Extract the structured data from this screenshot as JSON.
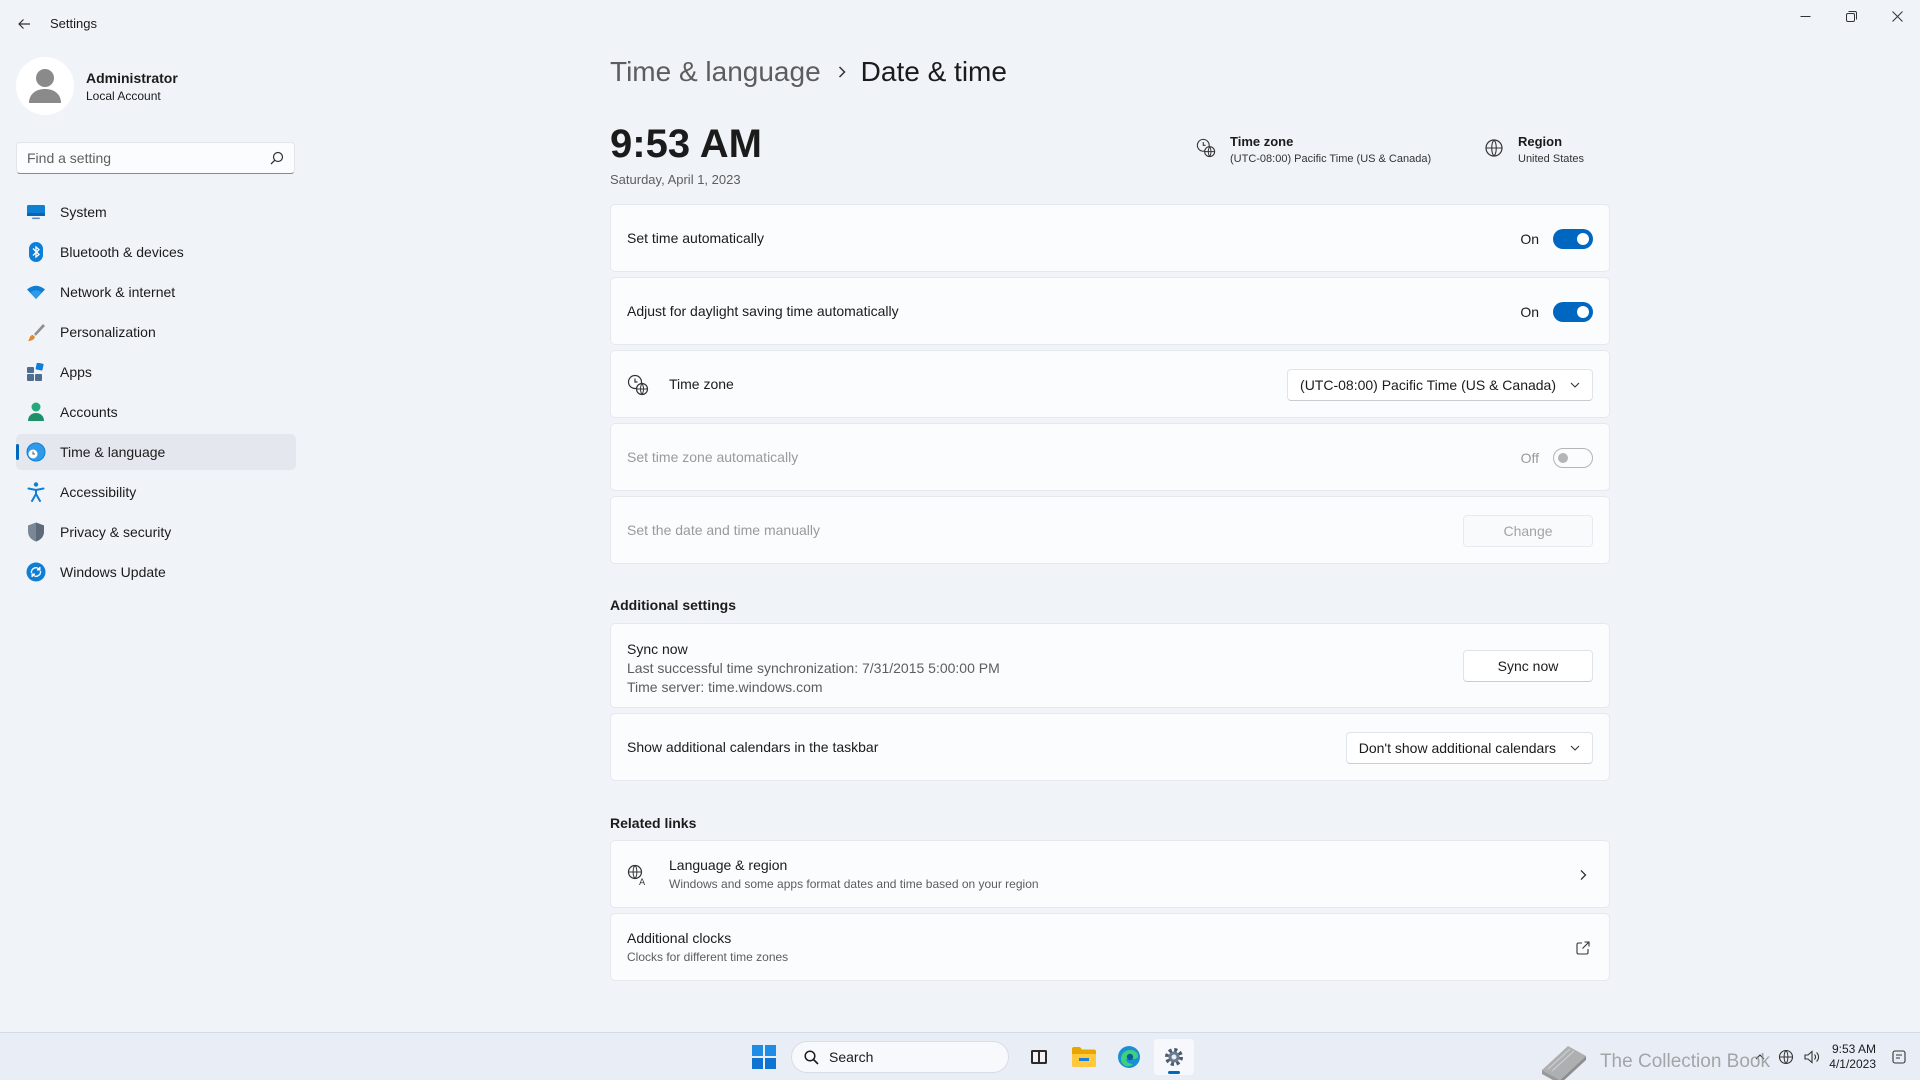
{
  "window": {
    "title": "Settings",
    "minimize_icon": "minimize-icon",
    "restore_icon": "restore-icon",
    "close_icon": "close-icon"
  },
  "user": {
    "name": "Administrator",
    "account_type": "Local Account"
  },
  "search": {
    "placeholder": "Find a setting"
  },
  "sidebar": {
    "items": [
      {
        "label": "System",
        "icon": "monitor-icon"
      },
      {
        "label": "Bluetooth & devices",
        "icon": "bluetooth-icon"
      },
      {
        "label": "Network & internet",
        "icon": "wifi-icon"
      },
      {
        "label": "Personalization",
        "icon": "brush-icon"
      },
      {
        "label": "Apps",
        "icon": "apps-icon"
      },
      {
        "label": "Accounts",
        "icon": "person-icon"
      },
      {
        "label": "Time & language",
        "icon": "globe-clock-icon",
        "active": true
      },
      {
        "label": "Accessibility",
        "icon": "accessibility-icon"
      },
      {
        "label": "Privacy & security",
        "icon": "shield-icon"
      },
      {
        "label": "Windows Update",
        "icon": "update-icon"
      }
    ]
  },
  "header": {
    "parent": "Time & language",
    "current": "Date & time"
  },
  "clock": {
    "time": "9:53 AM",
    "date": "Saturday, April 1, 2023"
  },
  "summary": {
    "timezone_title": "Time zone",
    "timezone_value": "(UTC-08:00) Pacific Time (US & Canada)",
    "region_title": "Region",
    "region_value": "United States"
  },
  "settings": {
    "set_time_auto": {
      "label": "Set time automatically",
      "state": "On"
    },
    "daylight": {
      "label": "Adjust for daylight saving time automatically",
      "state": "On"
    },
    "timezone": {
      "label": "Time zone",
      "value": "(UTC-08:00) Pacific Time (US & Canada)"
    },
    "timezone_auto": {
      "label": "Set time zone automatically",
      "state": "Off"
    },
    "manual": {
      "label": "Set the date and time manually",
      "button": "Change"
    }
  },
  "additional": {
    "title": "Additional settings",
    "sync": {
      "title": "Sync now",
      "last_sync": "Last successful time synchronization: 7/31/2015 5:00:00 PM",
      "server": "Time server: time.windows.com",
      "button": "Sync now"
    },
    "calendars": {
      "label": "Show additional calendars in the taskbar",
      "value": "Don't show additional calendars"
    }
  },
  "related": {
    "title": "Related links",
    "language_region": {
      "title": "Language & region",
      "subtitle": "Windows and some apps format dates and time based on your region"
    },
    "clocks": {
      "title": "Additional clocks",
      "subtitle": "Clocks for different time zones"
    }
  },
  "taskbar": {
    "search_label": "Search",
    "clock_time": "9:53 AM",
    "clock_date": "4/1/2023",
    "watermark": "The Collection Book"
  },
  "colors": {
    "accent": "#0067c0",
    "background": "#f0f4f9",
    "card": "#fbfcfe"
  }
}
